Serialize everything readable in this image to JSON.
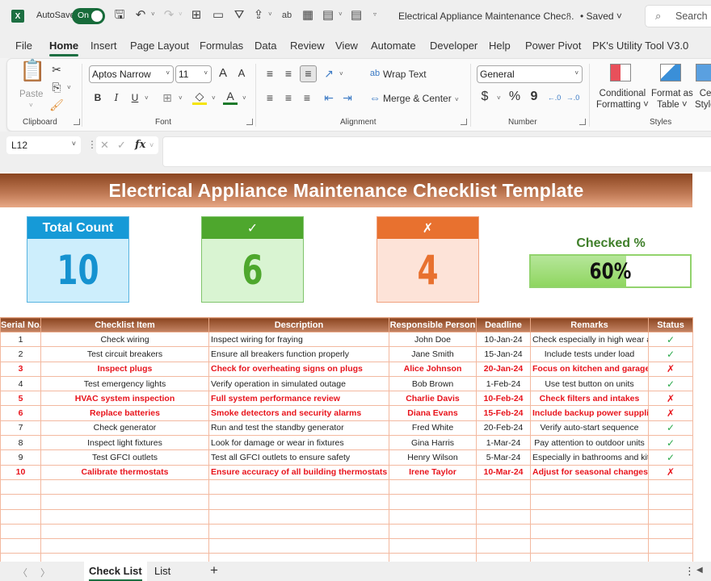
{
  "titlebar": {
    "app_icon": "X",
    "autosave_label": "AutoSave",
    "autosave_state": "On",
    "doc_title": "Electrical Appliance Maintenance Chec...",
    "saved_status": "• Saved",
    "search_placeholder": "Search",
    "icons": [
      "save-icon",
      "undo-icon",
      "redo-icon",
      "borders-icon",
      "picture-icon",
      "filter-icon",
      "share-icon",
      "spelling-icon",
      "form-icon",
      "calculator-icon",
      "customize-qat-icon"
    ]
  },
  "menu": {
    "tabs": [
      "File",
      "Home",
      "Insert",
      "Page Layout",
      "Formulas",
      "Data",
      "Review",
      "View",
      "Automate",
      "Developer",
      "Help",
      "Power Pivot",
      "PK's Utility Tool V3.0"
    ],
    "active": "Home"
  },
  "ribbon": {
    "clipboard": {
      "paste_label": "Paste",
      "group_label": "Clipboard"
    },
    "font": {
      "font_name": "Aptos Narrow",
      "font_size": "11",
      "group_label": "Font",
      "bold": "B",
      "italic": "I",
      "underline": "U",
      "grow": "A",
      "shrink": "A",
      "color": "A"
    },
    "alignment": {
      "wrap_text": "Wrap Text",
      "merge_center": "Merge & Center",
      "group_label": "Alignment"
    },
    "number": {
      "format": "General",
      "currency": "$",
      "percent": "%",
      "comma": "9",
      "group_label": "Number"
    },
    "styles": {
      "conditional_line1": "Conditional",
      "conditional_line2": "Formatting ˅",
      "format_table_line1": "Format as",
      "format_table_line2": "Table ˅",
      "cell_styles_line1": "Cell",
      "cell_styles_line2": "Styles",
      "group_label": "Styles"
    }
  },
  "formula_bar": {
    "name_box": "L12",
    "fx_label": "fx",
    "formula": ""
  },
  "sheet": {
    "title": "Electrical Appliance Maintenance Checklist Template",
    "kpis": {
      "total": {
        "label": "Total Count",
        "value": "10"
      },
      "checked": {
        "label": "✓",
        "value": "6"
      },
      "unchecked": {
        "label": "✗",
        "value": "4"
      }
    },
    "checked_pct": {
      "label": "Checked %",
      "value": 60,
      "text": "60%"
    },
    "columns": [
      "Serial No.",
      "Checklist Item",
      "Description",
      "Responsible Person",
      "Deadline",
      "Remarks",
      "Status"
    ],
    "rows": [
      {
        "no": "1",
        "item": "Check wiring",
        "desc": "Inspect wiring for fraying",
        "person": "John Doe",
        "deadline": "10-Jan-24",
        "remarks": "Check especially in high wear areas",
        "status": "✓",
        "done": true
      },
      {
        "no": "2",
        "item": "Test circuit breakers",
        "desc": "Ensure all breakers function properly",
        "person": "Jane Smith",
        "deadline": "15-Jan-24",
        "remarks": "Include tests under load",
        "status": "✓",
        "done": true
      },
      {
        "no": "3",
        "item": "Inspect plugs",
        "desc": "Check for overheating signs on plugs",
        "person": "Alice Johnson",
        "deadline": "20-Jan-24",
        "remarks": "Focus on kitchen and garage",
        "status": "✗",
        "done": false
      },
      {
        "no": "4",
        "item": "Test emergency lights",
        "desc": "Verify operation in simulated outage",
        "person": "Bob Brown",
        "deadline": "1-Feb-24",
        "remarks": "Use test button on units",
        "status": "✓",
        "done": true
      },
      {
        "no": "5",
        "item": "HVAC system inspection",
        "desc": "Full system performance review",
        "person": "Charlie Davis",
        "deadline": "10-Feb-24",
        "remarks": "Check filters and intakes",
        "status": "✗",
        "done": false
      },
      {
        "no": "6",
        "item": "Replace batteries",
        "desc": "Smoke detectors and security alarms",
        "person": "Diana Evans",
        "deadline": "15-Feb-24",
        "remarks": "Include backup power supplies",
        "status": "✗",
        "done": false
      },
      {
        "no": "7",
        "item": "Check generator",
        "desc": "Run and test the standby generator",
        "person": "Fred White",
        "deadline": "20-Feb-24",
        "remarks": "Verify auto-start sequence",
        "status": "✓",
        "done": true
      },
      {
        "no": "8",
        "item": "Inspect light fixtures",
        "desc": "Look for damage or wear in fixtures",
        "person": "Gina Harris",
        "deadline": "1-Mar-24",
        "remarks": "Pay attention to outdoor units",
        "status": "✓",
        "done": true
      },
      {
        "no": "9",
        "item": "Test GFCI outlets",
        "desc": "Test all GFCI outlets to ensure safety",
        "person": "Henry Wilson",
        "deadline": "5-Mar-24",
        "remarks": "Especially in bathrooms and kitchens",
        "status": "✓",
        "done": true
      },
      {
        "no": "10",
        "item": "Calibrate thermostats",
        "desc": "Ensure accuracy of all building thermostats",
        "person": "Irene Taylor",
        "deadline": "10-Mar-24",
        "remarks": "Adjust for seasonal changes",
        "status": "✗",
        "done": false
      }
    ],
    "empty_rows": 6,
    "colors": {
      "accent_brown": "#8b4520",
      "check_green": "#2aa84a",
      "cross_red": "#e8141c",
      "kpi_blue": "#169ad7",
      "kpi_green": "#4ea72d",
      "kpi_orange": "#e8712f"
    }
  },
  "sheet_tabs": {
    "tabs": [
      "Check List",
      "List"
    ],
    "active": "Check List",
    "add_label": "+"
  }
}
